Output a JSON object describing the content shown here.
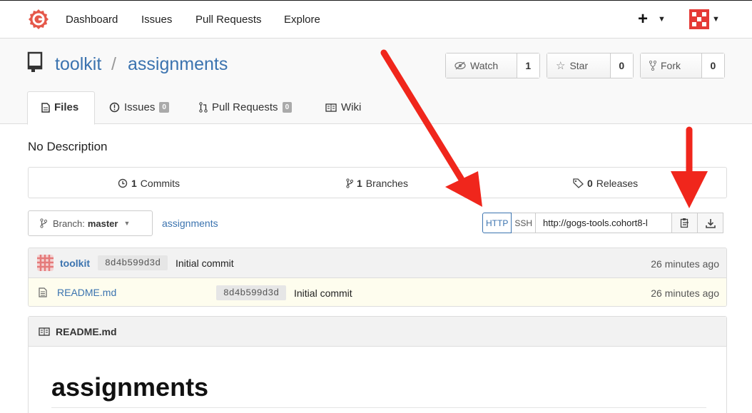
{
  "nav": {
    "items": [
      "Dashboard",
      "Issues",
      "Pull Requests",
      "Explore"
    ],
    "plus_label": "+"
  },
  "repo": {
    "owner": "toolkit",
    "separator": "/",
    "name": "assignments",
    "watch_label": "Watch",
    "watch_count": "1",
    "star_label": "Star",
    "star_count": "0",
    "fork_label": "Fork",
    "fork_count": "0"
  },
  "tabs": {
    "files": "Files",
    "issues": "Issues",
    "issues_count": "0",
    "pulls": "Pull Requests",
    "pulls_count": "0",
    "wiki": "Wiki"
  },
  "description": "No Description",
  "stats": {
    "commits_num": "1",
    "commits_label": "Commits",
    "branches_num": "1",
    "branches_label": "Branches",
    "releases_num": "0",
    "releases_label": "Releases"
  },
  "branch": {
    "prefix": "Branch:",
    "name": "master",
    "crumb": "assignments"
  },
  "clone": {
    "http_label": "HTTP",
    "ssh_label": "SSH",
    "url": "http://gogs-tools.cohort8-l"
  },
  "latest_commit": {
    "author": "toolkit",
    "sha": "8d4b599d3d",
    "message": "Initial commit",
    "time": "26 minutes ago"
  },
  "files": [
    {
      "name": "README.md",
      "sha": "8d4b599d3d",
      "message": "Initial commit",
      "time": "26 minutes ago"
    }
  ],
  "readme": {
    "filename": "README.md",
    "heading": "assignments"
  },
  "colors": {
    "link": "#3b73af",
    "arrow": "#f0261c",
    "logo": "#e5584a"
  }
}
